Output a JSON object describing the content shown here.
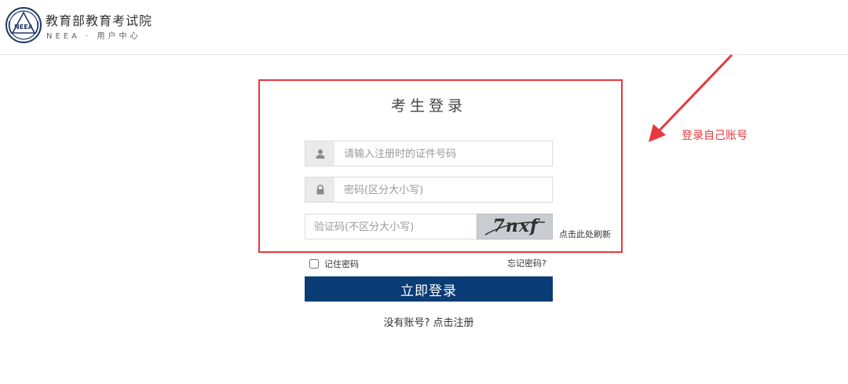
{
  "header": {
    "org_name": "教育部教育考试院",
    "subtitle": "NEEA · 用户中心",
    "logo_text": "NEEA"
  },
  "login": {
    "title": "考生登录",
    "id_placeholder": "请输入注册时的证件号码",
    "password_placeholder": "密码(区分大小写)",
    "captcha_placeholder": "验证码(不区分大小写)",
    "captcha_image_text": "7nxf",
    "refresh_label": "点击此处刷新",
    "remember_label": "记住密码",
    "forgot_label": "忘记密码?",
    "submit_label": "立即登录",
    "register_label": "没有账号? 点击注册"
  },
  "annotation": {
    "text": "登录自己账号",
    "color": "#e8383d"
  },
  "icons": [
    "user-icon",
    "lock-icon",
    "arrow-icon"
  ],
  "colors": {
    "primary_button": "#0a3c75",
    "annotation_red": "#e8383d"
  }
}
